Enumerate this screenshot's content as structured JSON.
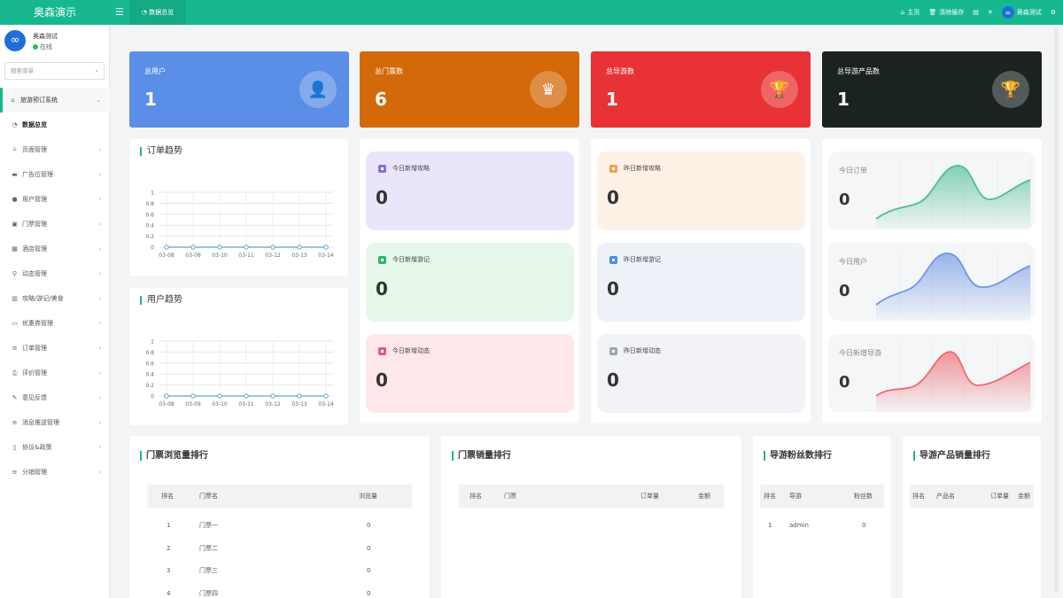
{
  "app": {
    "brand": "奥森演示",
    "active_tab": "数据总览"
  },
  "topbar": {
    "home": "主页",
    "clear_cache": "清除缓存",
    "user": "奥森测试"
  },
  "sidebar": {
    "user_name": "奥森测试",
    "user_status": "在线",
    "search_placeholder": "搜索菜单",
    "group": "旅游预订系统",
    "items": [
      {
        "label": "数据总览",
        "icon": "dashboard-icon"
      },
      {
        "label": "页面管理",
        "icon": "bookmark-icon"
      },
      {
        "label": "广告位管理",
        "icon": "card-icon"
      },
      {
        "label": "用户管理",
        "icon": "user-icon"
      },
      {
        "label": "门票管理",
        "icon": "ticket-icon"
      },
      {
        "label": "酒店管理",
        "icon": "building-icon"
      },
      {
        "label": "动态管理",
        "icon": "person-walk-icon"
      },
      {
        "label": "攻略/游记/美食",
        "icon": "book-icon"
      },
      {
        "label": "优惠券管理",
        "icon": "keyboard-icon"
      },
      {
        "label": "订单管理",
        "icon": "list-icon"
      },
      {
        "label": "评价管理",
        "icon": "print-icon"
      },
      {
        "label": "意见反馈",
        "icon": "feather-icon"
      },
      {
        "label": "消息推送管理",
        "icon": "list-icon"
      },
      {
        "label": "协议&政策",
        "icon": "file-icon"
      },
      {
        "label": "分销管理",
        "icon": "list-icon"
      }
    ]
  },
  "stats": [
    {
      "label": "总用户",
      "value": "1",
      "color": "#5b8ee6",
      "icon": "user-icon"
    },
    {
      "label": "总门票数",
      "value": "6",
      "color": "#d4690a",
      "icon": "crown-icon"
    },
    {
      "label": "总导游数",
      "value": "1",
      "color": "#e83236",
      "icon": "trophy-icon"
    },
    {
      "label": "总导游产品数",
      "value": "1",
      "color": "#1b2222",
      "icon": "trophy-icon"
    }
  ],
  "trend_panels": [
    {
      "title": "订单趋势"
    },
    {
      "title": "用户趋势"
    }
  ],
  "chart_data": [
    {
      "type": "line",
      "title": "订单趋势",
      "x": [
        "03-08",
        "03-09",
        "03-10",
        "03-11",
        "03-12",
        "03-13",
        "03-14"
      ],
      "series": [
        {
          "values": [
            0,
            0,
            0,
            0,
            0,
            0,
            0
          ]
        }
      ],
      "yticks": [
        "0",
        "0.2",
        "0.4",
        "0.6",
        "0.8",
        "1"
      ],
      "ylim": [
        0,
        1
      ],
      "grid": true
    },
    {
      "type": "line",
      "title": "用户趋势",
      "x": [
        "03-08",
        "03-09",
        "03-10",
        "03-11",
        "03-12",
        "03-13",
        "03-14"
      ],
      "series": [
        {
          "values": [
            0,
            0,
            0,
            0,
            0,
            0,
            0
          ]
        }
      ],
      "yticks": [
        "0",
        "0.2",
        "0.4",
        "0.6",
        "0.8",
        "1"
      ],
      "ylim": [
        0,
        1
      ],
      "grid": true
    }
  ],
  "mid_cards_left": [
    {
      "label": "今日新增攻略",
      "value": "0",
      "bg": "#ebe5fb",
      "icon_color": "#8a6cdc"
    },
    {
      "label": "今日新增游记",
      "value": "0",
      "bg": "#e6f7ea",
      "icon_color": "#32b36a"
    },
    {
      "label": "今日新增动态",
      "value": "0",
      "bg": "#fde7ea",
      "icon_color": "#e05d72"
    }
  ],
  "mid_cards_right": [
    {
      "label": "昨日新增攻略",
      "value": "0",
      "bg": "#fdf1e6",
      "icon_color": "#f0a04b"
    },
    {
      "label": "昨日新增游记",
      "value": "0",
      "bg": "#eef2f8",
      "icon_color": "#4a8ee6"
    },
    {
      "label": "昨日新增动态",
      "value": "0",
      "bg": "#f2f3f6",
      "icon_color": "#a0a4ad"
    }
  ],
  "spark_cards": [
    {
      "label": "今日订单",
      "value": "0",
      "color": "#4fbf94"
    },
    {
      "label": "今日用户",
      "value": "0",
      "color": "#6f97e6"
    },
    {
      "label": "今日新增导游",
      "value": "0",
      "color": "#ec6a6f"
    }
  ],
  "tables": {
    "ticket_views": {
      "title": "门票浏览量排行",
      "headers": [
        "排名",
        "门票名",
        "浏览量"
      ],
      "rows": [
        [
          "1",
          "门票一",
          "0"
        ],
        [
          "2",
          "门票二",
          "0"
        ],
        [
          "3",
          "门票三",
          "0"
        ],
        [
          "4",
          "门票四",
          "0"
        ]
      ]
    },
    "ticket_sales": {
      "title": "门票销量排行",
      "headers": [
        "排名",
        "门票",
        "订单量",
        "金额"
      ],
      "rows": []
    },
    "guide_fans": {
      "title": "导游粉丝数排行",
      "headers": [
        "排名",
        "导游",
        "粉丝数"
      ],
      "rows": [
        [
          "1",
          "admin",
          "0"
        ]
      ]
    },
    "guide_products": {
      "title": "导游产品销量排行",
      "headers": [
        "排名",
        "产品名",
        "订单量",
        "金额"
      ],
      "rows": []
    }
  }
}
